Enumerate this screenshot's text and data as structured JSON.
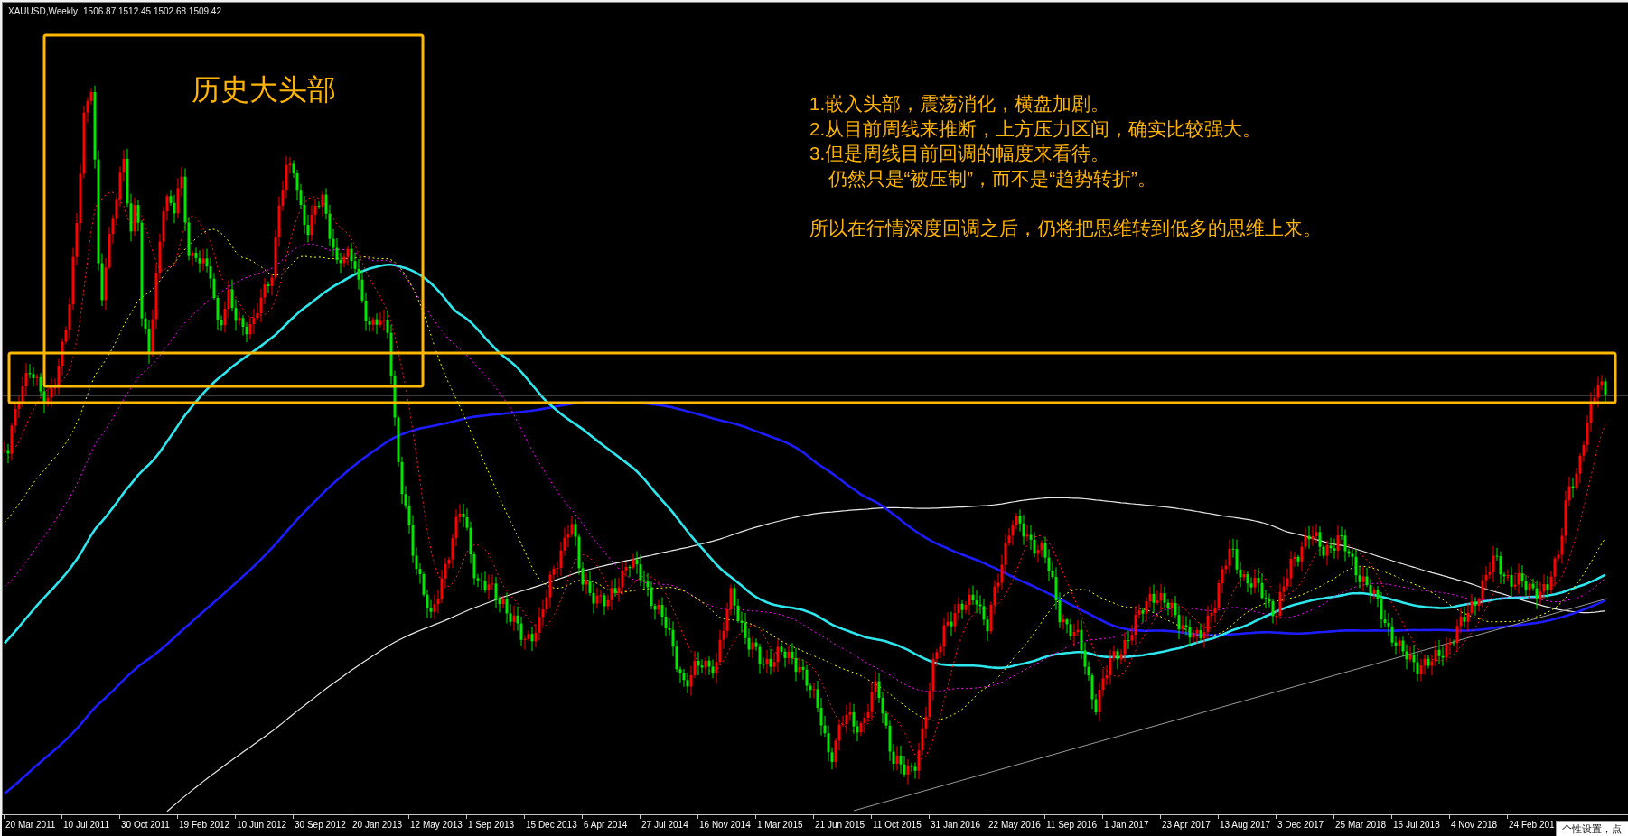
{
  "chart": {
    "symbol": "XAUUSD,Weekly",
    "quote": "1506.87 1512.45 1502.68 1509.42"
  },
  "zone_label": "历史大头部",
  "notes": [
    {
      "kind": "point",
      "text": "1.嵌入头部，震荡消化，横盘加剧。"
    },
    {
      "kind": "point",
      "text": "2.从目前周线来推断，上方压力区间，确实比较强大。"
    },
    {
      "kind": "point",
      "text": "3.但是周线目前回调的幅度来看待。"
    },
    {
      "kind": "continuation",
      "text": "仍然只是“被压制”，而不是“趋势转折”。"
    },
    {
      "kind": "conclusion",
      "text": "所以在行情深度回调之后，仍将把思维转到低多的思维上来。"
    }
  ],
  "x_axis": {
    "labels": [
      "20 Mar 2011",
      "10 Jul 2011",
      "30 Oct 2011",
      "19 Feb 2012",
      "10 Jun 2012",
      "30 Sep 2012",
      "20 Jan 2013",
      "12 May 2013",
      "1 Sep 2013",
      "15 Dec 2013",
      "6 Apr 2014",
      "27 Jul 2014",
      "16 Nov 2014",
      "1 Mar 2015",
      "21 Jun 2015",
      "11 Oct 2015",
      "31 Jan 2016",
      "22 May 2016",
      "11 Sep 2016",
      "1 Jan 2017",
      "23 Apr 2017",
      "13 Aug 2017",
      "3 Dec 2017",
      "25 Mar 2018",
      "15 Jul 2018",
      "4 Nov 2018",
      "24 Feb 201"
    ]
  },
  "popup": {
    "text": "个性设置，点"
  }
}
